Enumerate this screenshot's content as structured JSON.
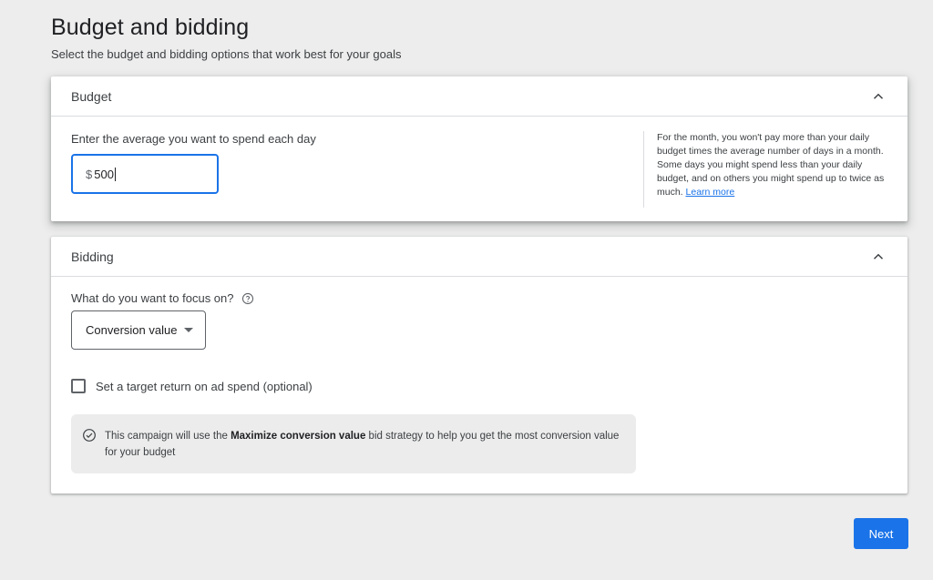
{
  "header": {
    "title": "Budget and bidding",
    "subtitle": "Select the budget and bidding options that work best for your goals"
  },
  "budget": {
    "title": "Budget",
    "collapse_icon": "chevron-up-icon",
    "input_label": "Enter the average you want to spend each day",
    "currency_symbol": "$",
    "value": "500",
    "help_text": "For the month, you won't pay more than your daily budget times the average number of days in a month. Some days you might spend less than your daily budget, and on others you might spend up to twice as much.",
    "learn_more": "Learn more"
  },
  "bidding": {
    "title": "Bidding",
    "collapse_icon": "chevron-up-icon",
    "focus_label": "What do you want to focus on?",
    "help_icon": "help-circle-icon",
    "focus_selected": "Conversion value",
    "target_checkbox_label": "Set a target return on ad spend (optional)",
    "target_checked": false,
    "info_prefix": "This campaign will use the ",
    "info_strategy": "Maximize conversion value",
    "info_suffix": " bid strategy to help you get the most conversion value for your budget",
    "info_icon": "check-circle-icon"
  },
  "footer": {
    "next_label": "Next"
  },
  "colors": {
    "accent": "#1a73e8",
    "background": "#ededed",
    "card": "#ffffff"
  }
}
